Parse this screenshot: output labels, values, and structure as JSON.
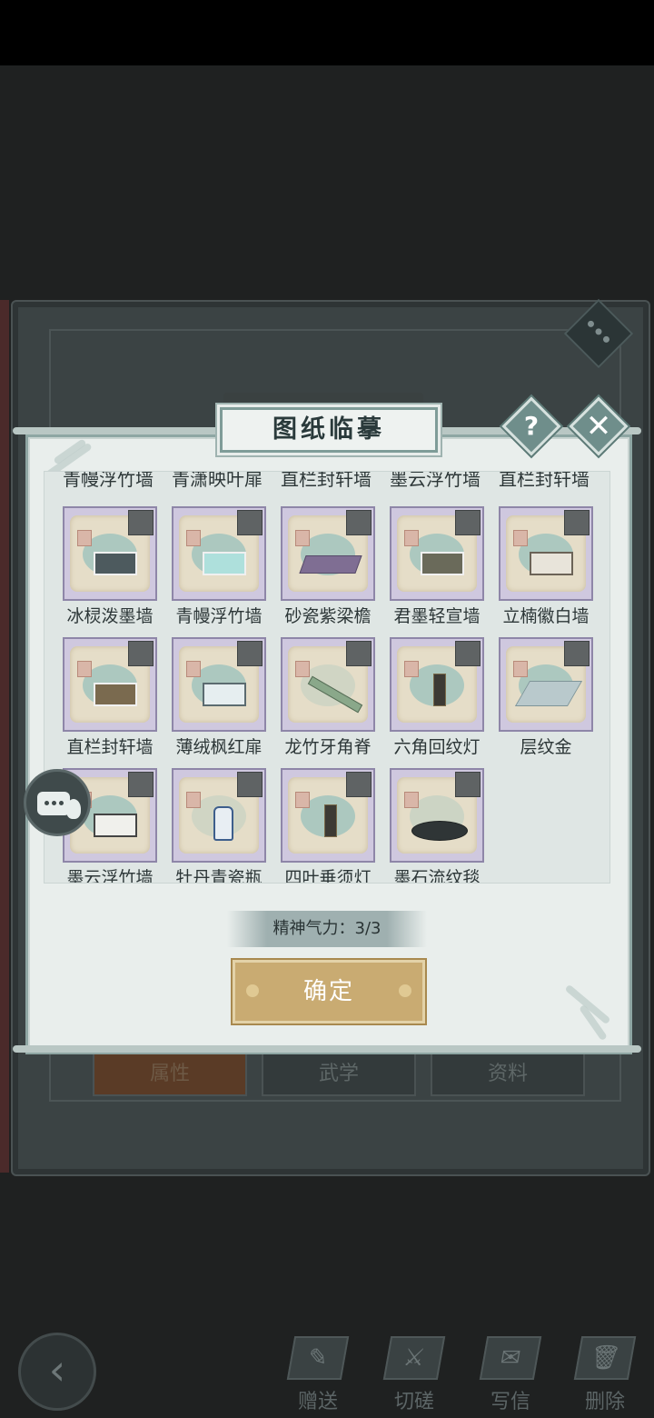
{
  "dialog": {
    "title": "图纸临摹",
    "help_label": "?",
    "close_label": "✕",
    "partial_row": [
      "青幔浮竹墙",
      "青潇映叶扉",
      "直栏封轩墙",
      "墨云浮竹墙",
      "直栏封轩墙"
    ],
    "items": [
      {
        "name": "冰棂泼墨墙",
        "icon": "wall-building-icon"
      },
      {
        "name": "青幔浮竹墙",
        "icon": "wall-building-icon"
      },
      {
        "name": "砂瓷紫梁檐",
        "icon": "roof-eave-icon"
      },
      {
        "name": "君墨轻宣墙",
        "icon": "wall-building-icon"
      },
      {
        "name": "立楠徽白墙",
        "icon": "wall-building-icon"
      },
      {
        "name": "直栏封轩墙",
        "icon": "wall-building-icon"
      },
      {
        "name": "薄绒枫红扉",
        "icon": "wall-building-icon"
      },
      {
        "name": "龙竹牙角脊",
        "icon": "ridge-stick-icon"
      },
      {
        "name": "六角回纹灯",
        "icon": "lantern-icon"
      },
      {
        "name": "层纹金",
        "icon": "floor-tile-icon"
      },
      {
        "name": "墨云浮竹墙",
        "icon": "wall-building-icon"
      },
      {
        "name": "牡丹青瓷瓶",
        "icon": "vase-icon"
      },
      {
        "name": "四叶垂须灯",
        "icon": "lantern-icon"
      },
      {
        "name": "墨石流纹毯",
        "icon": "rug-icon"
      }
    ],
    "energy_text": "精神气力：3/3",
    "confirm_label": "确定"
  },
  "background": {
    "tabs": [
      "属性",
      "武学",
      "资料"
    ]
  },
  "toolbar": {
    "back_label": "‹",
    "items": [
      {
        "label": "赠送",
        "icon": "gift-scroll-icon"
      },
      {
        "label": "切磋",
        "icon": "sword-icon"
      },
      {
        "label": "写信",
        "icon": "letter-icon"
      },
      {
        "label": "删除",
        "icon": "trash-icon"
      }
    ]
  },
  "colors": {
    "dialog_bg": "#e9eeec",
    "card_bg": "#cfc8df",
    "confirm_button": "#c9ab72",
    "accent_teal": "#6f8e8b"
  }
}
